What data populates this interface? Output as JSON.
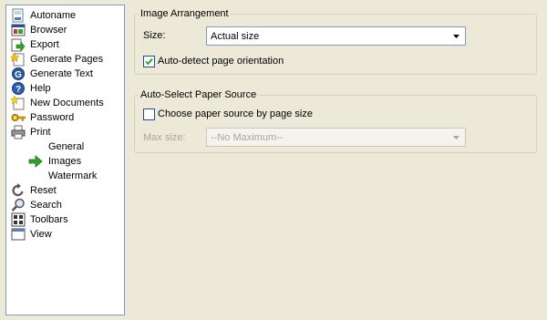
{
  "sidebar": {
    "items": [
      {
        "label": "Autoname",
        "icon": "autoname-icon"
      },
      {
        "label": "Browser",
        "icon": "browser-icon"
      },
      {
        "label": "Export",
        "icon": "export-icon"
      },
      {
        "label": "Generate Pages",
        "icon": "generate-pages-icon"
      },
      {
        "label": "Generate Text",
        "icon": "generate-text-icon"
      },
      {
        "label": "Help",
        "icon": "help-icon"
      },
      {
        "label": "New Documents",
        "icon": "new-documents-icon"
      },
      {
        "label": "Password",
        "icon": "password-key-icon"
      },
      {
        "label": "Print",
        "icon": "printer-icon"
      },
      {
        "label": "General",
        "icon": ""
      },
      {
        "label": "Images",
        "icon": "green-arrow-icon",
        "selected": true
      },
      {
        "label": "Watermark",
        "icon": ""
      },
      {
        "label": "Reset",
        "icon": "reset-icon"
      },
      {
        "label": "Search",
        "icon": "search-icon"
      },
      {
        "label": "Toolbars",
        "icon": "toolbars-icon"
      },
      {
        "label": "View",
        "icon": "view-icon"
      }
    ]
  },
  "image_arrangement": {
    "title": "Image Arrangement",
    "size_label": "Size:",
    "size_value": "Actual size",
    "auto_detect_label": "Auto-detect page orientation",
    "auto_detect_checked": true
  },
  "paper_source": {
    "title": "Auto-Select Paper Source",
    "choose_label": "Choose paper source by page size",
    "choose_checked": false,
    "max_size_label": "Max size:",
    "max_size_value": "--No Maximum--"
  },
  "colors": {
    "background": "#ece9d8",
    "border": "#7f9db9",
    "disabled_text": "#a7a69a",
    "arrow_green": "#2fa52a"
  }
}
